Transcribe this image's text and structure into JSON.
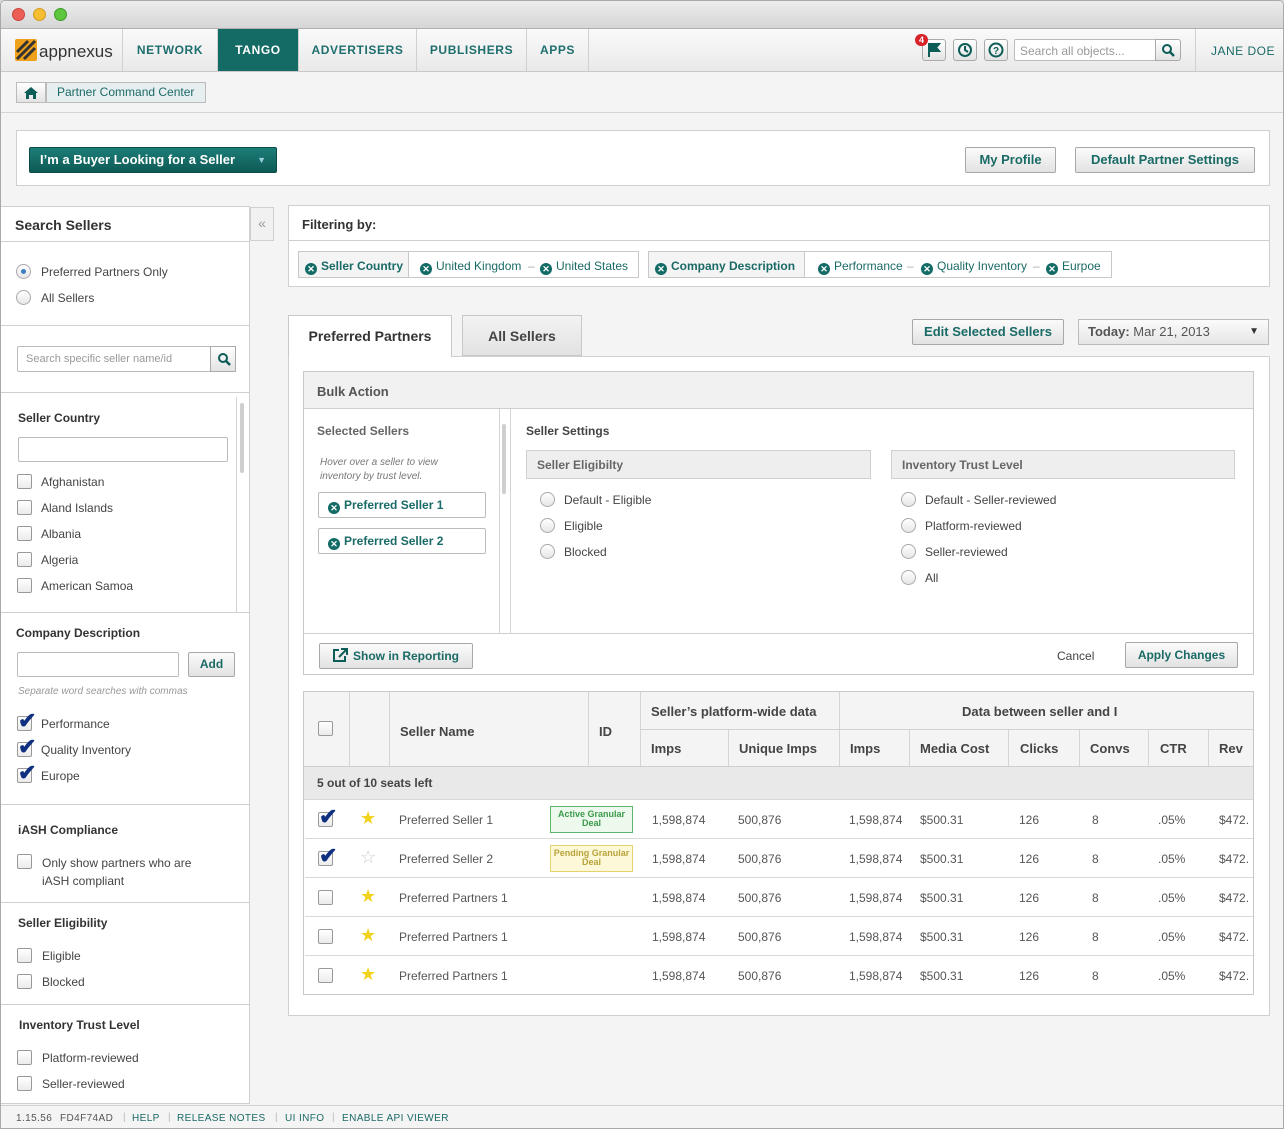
{
  "nav": {
    "brand": "appnexus",
    "items": [
      "NETWORK",
      "TANGO",
      "ADVERTISERS",
      "PUBLISHERS",
      "APPS"
    ],
    "notification_count": "4",
    "search_placeholder": "Search all objects...",
    "user": "JANE DOE"
  },
  "breadcrumb": {
    "label": "Partner Command Center"
  },
  "toolbar": {
    "role_button": "I’m a Buyer Looking for a Seller",
    "my_profile": "My Profile",
    "default_settings": "Default Partner Settings"
  },
  "sidebar": {
    "title": "Search Sellers",
    "collapse": "«",
    "radio_preferred": "Preferred Partners Only",
    "radio_all": "All Sellers",
    "search_placeholder": "Search specific seller name/id",
    "country": {
      "title": "Seller Country",
      "items": [
        "Afghanistan",
        "Aland Islands",
        "Albania",
        "Algeria",
        "American Samoa"
      ]
    },
    "company": {
      "title": "Company Description",
      "add": "Add",
      "hint": "Separate word searches with commas",
      "items": [
        "Performance",
        "Quality Inventory",
        "Europe"
      ]
    },
    "iash": {
      "title": "iASH Compliance",
      "option_line1": "Only show partners who are",
      "option_line2": "iASH compliant"
    },
    "eligibility": {
      "title": "Seller Eligibility",
      "items": [
        "Eligible",
        "Blocked"
      ]
    },
    "trust": {
      "title": "Inventory Trust Level",
      "items": [
        "Platform-reviewed",
        "Seller-reviewed"
      ]
    }
  },
  "filters": {
    "title": "Filtering by:",
    "group1": {
      "label": "Seller Country",
      "values": [
        "United Kingdom",
        "United States"
      ]
    },
    "group2": {
      "label": "Company Description",
      "values": [
        "Performance",
        "Quality Inventory",
        "Eurpoe"
      ]
    },
    "dash": "–"
  },
  "tabs": {
    "preferred": "Preferred Partners",
    "all": "All Sellers"
  },
  "actions": {
    "edit_selected": "Edit Selected Sellers",
    "date_label": "Today:",
    "date_value": "Mar 21, 2013"
  },
  "bulk": {
    "title": "Bulk Action",
    "selected_title": "Selected Sellers",
    "hint": "Hover over a seller to view inventory by trust level.",
    "selected": [
      "Preferred Seller 1",
      "Preferred Seller 2"
    ],
    "settings_title": "Seller Settings",
    "eligibility": {
      "title": "Seller Eligibilty",
      "options": [
        "Default - Eligible",
        "Eligible",
        "Blocked"
      ]
    },
    "trust": {
      "title": "Inventory Trust Level",
      "options": [
        "Default - Seller-reviewed",
        "Platform-reviewed",
        "Seller-reviewed",
        "All"
      ]
    },
    "show_reporting": "Show in Reporting",
    "cancel": "Cancel",
    "apply": "Apply Changes"
  },
  "table": {
    "headers": {
      "name": "Seller Name",
      "id": "ID",
      "platform_group": "Seller’s platform-wide data",
      "seller_group": "Data between seller and I",
      "imps": "Imps",
      "unique_imps": "Unique Imps",
      "imps2": "Imps",
      "media_cost": "Media Cost",
      "clicks": "Clicks",
      "convs": "Convs",
      "ctr": "CTR",
      "rev": "Rev"
    },
    "seats": "5 out of 10 seats left",
    "rows": [
      {
        "name": "Preferred Seller 1",
        "badge": "Active Granular Deal",
        "imps": "1,598,874",
        "unique": "500,876",
        "imps2": "1,598,874",
        "cost": "$500.31",
        "clicks": "126",
        "convs": "8",
        "ctr": ".05%",
        "rev": "$472."
      },
      {
        "name": "Preferred Seller 2",
        "badge": "Pending Granular Deal",
        "imps": "1,598,874",
        "unique": "500,876",
        "imps2": "1,598,874",
        "cost": "$500.31",
        "clicks": "126",
        "convs": "8",
        "ctr": ".05%",
        "rev": "$472."
      },
      {
        "name": "Preferred Partners 1",
        "badge": "",
        "imps": "1,598,874",
        "unique": "500,876",
        "imps2": "1,598,874",
        "cost": "$500.31",
        "clicks": "126",
        "convs": "8",
        "ctr": ".05%",
        "rev": "$472."
      },
      {
        "name": "Preferred Partners 1",
        "badge": "",
        "imps": "1,598,874",
        "unique": "500,876",
        "imps2": "1,598,874",
        "cost": "$500.31",
        "clicks": "126",
        "convs": "8",
        "ctr": ".05%",
        "rev": "$472."
      },
      {
        "name": "Preferred Partners 1",
        "badge": "",
        "imps": "1,598,874",
        "unique": "500,876",
        "imps2": "1,598,874",
        "cost": "$500.31",
        "clicks": "126",
        "convs": "8",
        "ctr": ".05%",
        "rev": "$472."
      }
    ]
  },
  "footer": {
    "version": "1.15.56",
    "build": "FD4F74AD",
    "links": [
      "HELP",
      "RELEASE NOTES",
      "UI INFO",
      "ENABLE API VIEWER"
    ]
  },
  "colors": {
    "brand": "#146b66",
    "accent_link": "#1a6a66",
    "notification": "#d8232a",
    "star": "#f2d21b"
  }
}
